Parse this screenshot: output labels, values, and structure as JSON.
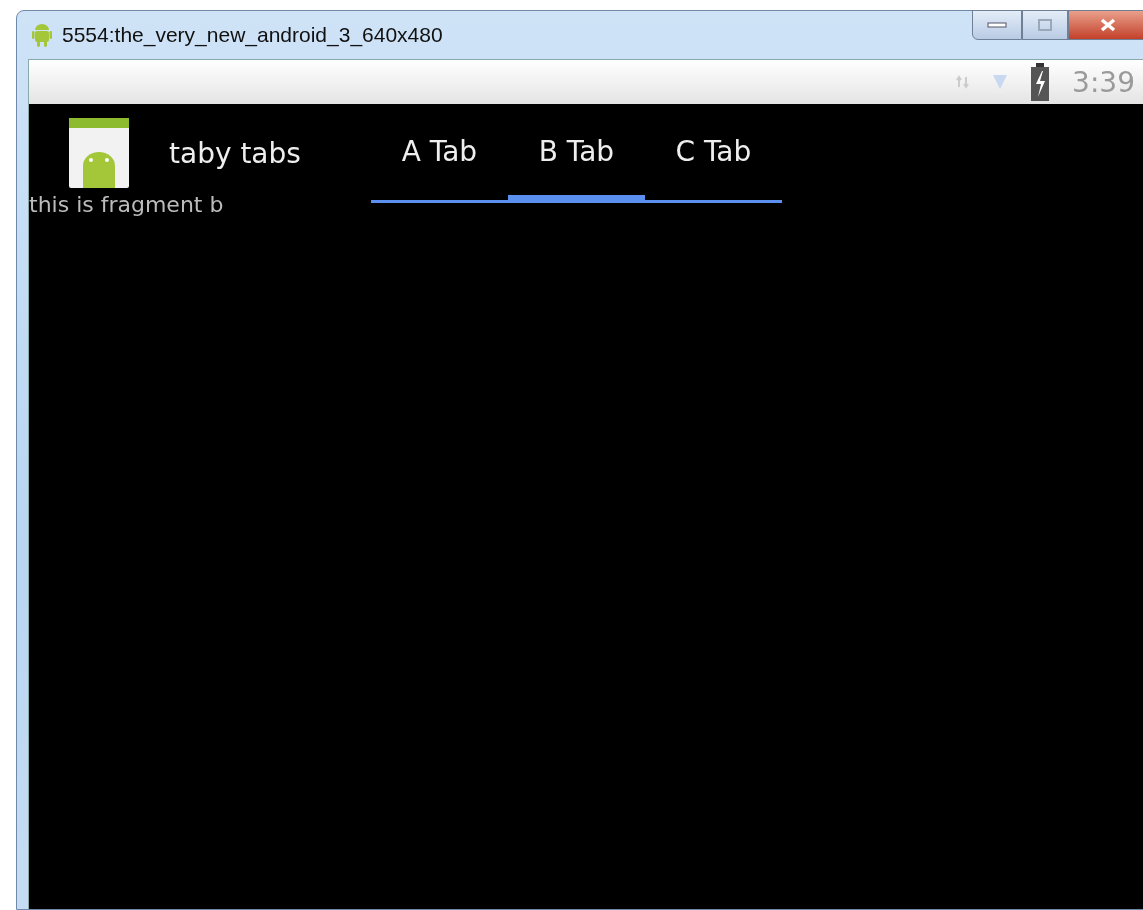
{
  "window": {
    "title": "5554:the_very_new_android_3_640x480"
  },
  "status_bar": {
    "clock": "3:39"
  },
  "action_bar": {
    "title": "taby tabs"
  },
  "tabs": [
    {
      "label": "A Tab",
      "selected": false
    },
    {
      "label": "B Tab",
      "selected": true
    },
    {
      "label": "C Tab",
      "selected": false
    }
  ],
  "content": {
    "text": "this is fragment b"
  }
}
